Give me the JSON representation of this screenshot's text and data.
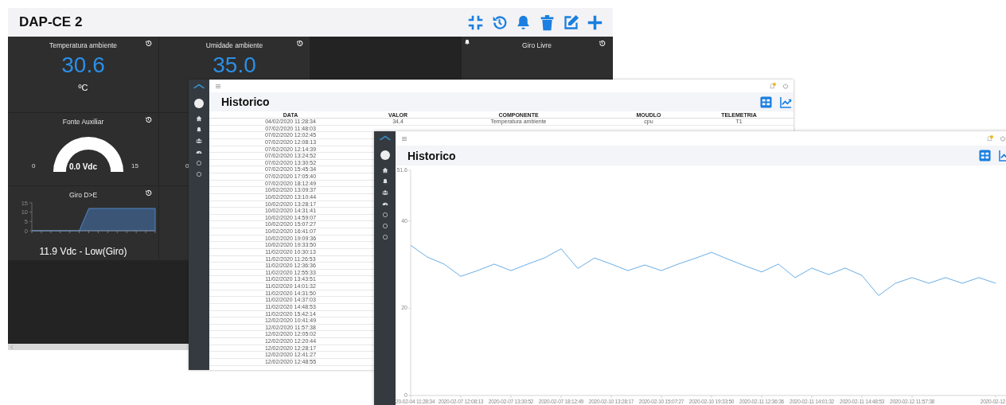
{
  "dashboard": {
    "title": "DAP-CE 2",
    "card_rows": [
      [
        {
          "kind": "value",
          "title": "Temperatura ambiente",
          "value": "30.6",
          "unit": "ºC"
        },
        {
          "kind": "value",
          "title": "Umidade ambiente",
          "value": "35.0"
        },
        {
          "kind": "gap"
        },
        {
          "kind": "status",
          "title": "Giro Livre"
        }
      ],
      [
        {
          "kind": "gauge",
          "title": "Fonte Auxiliar",
          "min": "0",
          "max": "15",
          "reading": "0.0 Vdc"
        },
        {
          "kind": "scale",
          "min": "0"
        }
      ],
      [
        {
          "kind": "chart",
          "title": "Giro D>E",
          "reading": "11.9 Vdc - Low(Giro)",
          "chart_data": {
            "type": "area",
            "ylim": [
              0,
              15
            ],
            "yticks": [
              0,
              5,
              10,
              15
            ],
            "values": [
              0,
              0,
              0,
              0,
              0,
              0,
              12,
              12,
              12,
              12,
              12,
              12,
              12,
              12
            ]
          }
        },
        {
          "kind": "blank"
        }
      ]
    ]
  },
  "history_table": {
    "title": "Historico",
    "columns": [
      "DATA",
      "VALOR",
      "COMPONENTE",
      "MOUDLO",
      "TELEMETRIA"
    ],
    "rows": [
      [
        "04/02/2020 11:28:34",
        "34,4",
        "Temperatura ambiente",
        "cpu",
        "T1"
      ],
      [
        "07/02/2020 11:48:03"
      ],
      [
        "07/02/2020 12:02:45"
      ],
      [
        "07/02/2020 12:08:13"
      ],
      [
        "07/02/2020 12:14:39"
      ],
      [
        "07/02/2020 13:24:52"
      ],
      [
        "07/02/2020 13:30:52"
      ],
      [
        "07/02/2020 15:45:34"
      ],
      [
        "07/02/2020 17:05:40"
      ],
      [
        "07/02/2020 18:12:49"
      ],
      [
        "10/02/2020 13:09:37"
      ],
      [
        "10/02/2020 13:10:44"
      ],
      [
        "10/02/2020 13:28:17"
      ],
      [
        "10/02/2020 14:31:41"
      ],
      [
        "10/02/2020 14:59:07"
      ],
      [
        "10/02/2020 15:07:27"
      ],
      [
        "10/02/2020 16:41:07"
      ],
      [
        "10/02/2020 19:09:36"
      ],
      [
        "10/02/2020 19:33:50"
      ],
      [
        "11/02/2020 10:30:13"
      ],
      [
        "11/02/2020 11:26:53"
      ],
      [
        "11/02/2020 12:36:36"
      ],
      [
        "11/02/2020 12:55:33"
      ],
      [
        "11/02/2020 13:43:51"
      ],
      [
        "11/02/2020 14:01:32"
      ],
      [
        "11/02/2020 14:31:50"
      ],
      [
        "11/02/2020 14:37:03"
      ],
      [
        "11/02/2020 14:48:53"
      ],
      [
        "11/02/2020 15:42:14"
      ],
      [
        "12/02/2020 10:41:49"
      ],
      [
        "12/02/2020 11:57:38"
      ],
      [
        "12/02/2020 12:05:02"
      ],
      [
        "12/02/2020 12:20:44"
      ],
      [
        "12/02/2020 12:28:17"
      ],
      [
        "12/02/2020 12:41:27"
      ],
      [
        "12/02/2020 12:48:55"
      ]
    ]
  },
  "history_chart": {
    "title": "Historico",
    "chart_data": {
      "type": "line",
      "ylim": [
        0,
        51.6
      ],
      "yticks": [
        0,
        20,
        40,
        {
          "value": 51.6,
          "label": "51.6"
        }
      ],
      "categories": [
        "20-02-04 11:28:34",
        null,
        null,
        "2020-02-07 12:08:13",
        null,
        null,
        "2020-02-07 13:30:52",
        null,
        null,
        "2020-02-07 18:12:49",
        null,
        null,
        "2020-02-10 13:28:17",
        null,
        null,
        "2020-02-10 15:07:27",
        null,
        null,
        "2020-02-10 19:33:50",
        null,
        null,
        "2020-02-11 12:36:36",
        null,
        null,
        "2020-02-11 14:01:32",
        null,
        null,
        "2020-02-11 14:48:53",
        null,
        null,
        "2020-02-12 11:57:38",
        null,
        null,
        null,
        null,
        "2020-02-12"
      ],
      "series": [
        {
          "color": "#6aaee6",
          "values": [
            34.4,
            31.7,
            30.1,
            27.3,
            28.6,
            30.1,
            28.6,
            30.1,
            31.5,
            33.6,
            29.1,
            31.5,
            30.1,
            28.6,
            29.9,
            28.6,
            30.1,
            31.4,
            32.8,
            31.2,
            29.7,
            28.3,
            30.1,
            27.0,
            29.2,
            27.7,
            29.2,
            27.5,
            22.9,
            25.7,
            27.0,
            25.7,
            27.0,
            25.7,
            27.0,
            25.7
          ]
        }
      ]
    }
  }
}
